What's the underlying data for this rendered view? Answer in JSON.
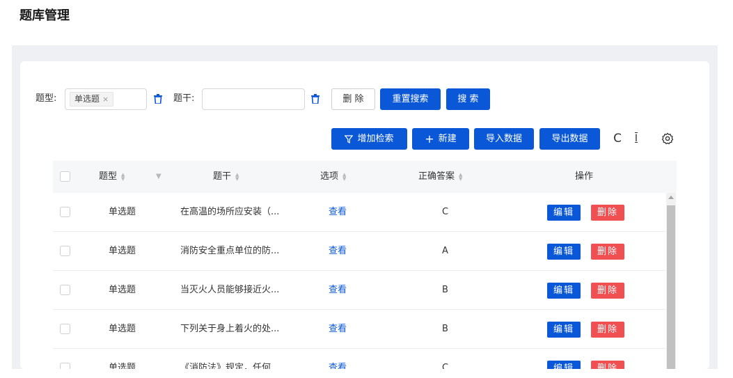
{
  "page": {
    "title": "题库管理"
  },
  "search": {
    "type_label": "题型:",
    "type_tag": "单选题",
    "tag_close": "×",
    "stem_label": "题干:",
    "stem_value": "",
    "delete_label": "删 除",
    "reset_label": "重置搜索",
    "search_label": "搜 索"
  },
  "toolbar": {
    "add_filter_label": "增加检索",
    "new_label": "新建",
    "import_label": "导入数据",
    "export_label": "导出数据",
    "refresh_icon": "C",
    "density_icon": "I"
  },
  "table": {
    "columns": [
      "题型",
      "题干",
      "选项",
      "正确答案",
      "操作"
    ],
    "rows": [
      {
        "type": "单选题",
        "stem": "在高温的场所应安装（...",
        "options": "查看",
        "answer": "C"
      },
      {
        "type": "单选题",
        "stem": "消防安全重点单位的防...",
        "options": "查看",
        "answer": "A"
      },
      {
        "type": "单选题",
        "stem": "当灭火人员能够接近火...",
        "options": "查看",
        "answer": "B"
      },
      {
        "type": "单选题",
        "stem": "下列关于身上着火的处...",
        "options": "查看",
        "answer": "B"
      },
      {
        "type": "单选题",
        "stem": "《消防法》规定，任何...",
        "options": "查看",
        "answer": "C"
      }
    ],
    "edit_label": "编辑",
    "delete_label": "删除"
  },
  "colors": {
    "primary": "#0a57d8",
    "danger": "#f05052",
    "page_bg": "#eef0f4"
  }
}
